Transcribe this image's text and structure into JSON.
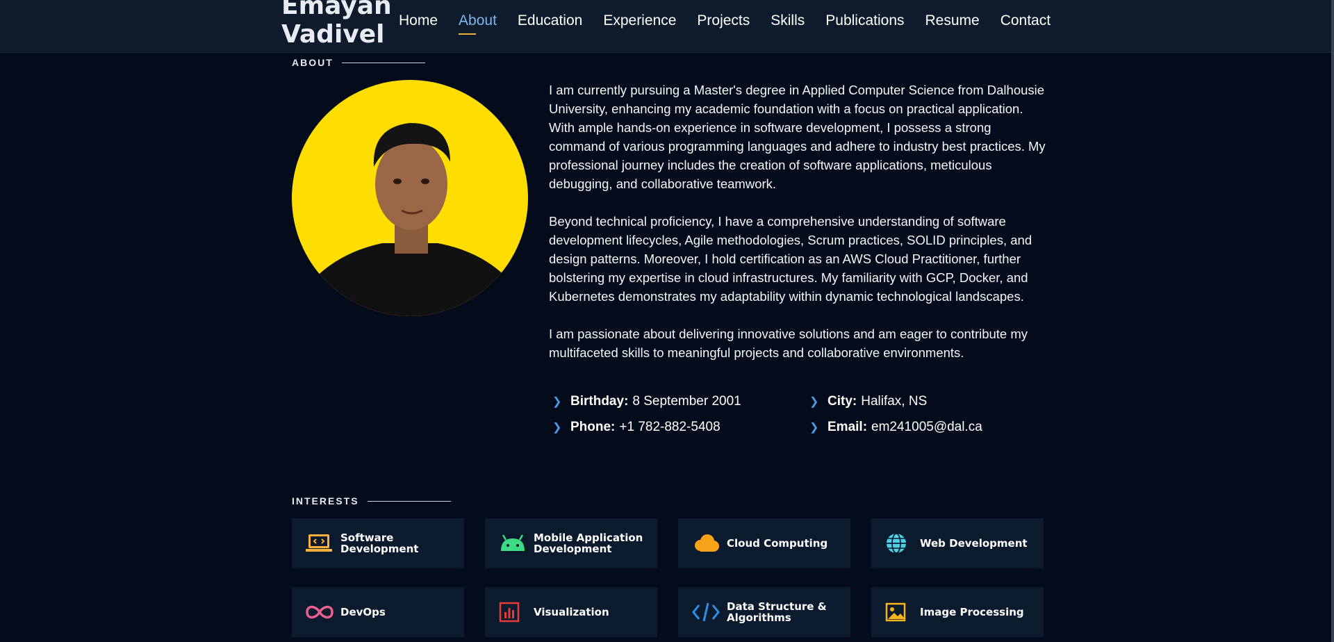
{
  "brand": {
    "line1": "Emayan",
    "line2": "Vadivel"
  },
  "nav": {
    "items": [
      "Home",
      "About",
      "Education",
      "Experience",
      "Projects",
      "Skills",
      "Publications",
      "Resume",
      "Contact"
    ],
    "active": "About"
  },
  "about": {
    "title": "ABOUT",
    "paragraphs": [
      "I am currently pursuing a Master's degree in Applied Computer Science from Dalhousie University, enhancing my academic foundation with a focus on practical application. With ample hands-on experience in software development, I possess a strong command of various programming languages and adhere to industry best practices. My professional journey includes the creation of software applications, meticulous debugging, and collaborative teamwork.",
      "Beyond technical proficiency, I have a comprehensive understanding of software development lifecycles, Agile methodologies, Scrum practices, SOLID principles, and design patterns. Moreover, I hold certification as an AWS Cloud Practitioner, further bolstering my expertise in cloud infrastructures. My familiarity with GCP, Docker, and Kubernetes demonstrates my adaptability within dynamic technological landscapes.",
      "I am passionate about delivering innovative solutions and am eager to contribute my multifaceted skills to meaningful projects and collaborative environments."
    ],
    "info": {
      "birthday_label": "Birthday:",
      "birthday": "8 September 2001",
      "city_label": "City:",
      "city": "Halifax, NS",
      "phone_label": "Phone:",
      "phone": "+1 782-882-5408",
      "email_label": "Email:",
      "email": "em241005@dal.ca"
    }
  },
  "interests": {
    "title": "INTERESTS",
    "items": [
      {
        "label": "Software Development",
        "icon": "laptop-code-icon",
        "color": "#ffb03b"
      },
      {
        "label": "Mobile Application Development",
        "icon": "android-icon",
        "color": "#3ddc84"
      },
      {
        "label": "Cloud Computing",
        "icon": "cloud-icon",
        "color": "#f7a31a"
      },
      {
        "label": "Web Development",
        "icon": "globe-icon",
        "color": "#4dd0e8"
      },
      {
        "label": "DevOps",
        "icon": "infinity-icon",
        "color": "#e8608f"
      },
      {
        "label": "Visualization",
        "icon": "bar-chart-icon",
        "color": "#e83a3a"
      },
      {
        "label": "Data Structure & Algorithms",
        "icon": "code-icon",
        "color": "#2e8fe8"
      },
      {
        "label": "Image Processing",
        "icon": "image-icon",
        "color": "#f7b51a"
      }
    ]
  },
  "colors": {
    "accent": "#7fb6ee",
    "underline": "#e8b53a",
    "background": "#040b1a",
    "navbar": "#0d1b2d",
    "card": "#0c1a2e",
    "avatar_bg": "#fede00"
  }
}
